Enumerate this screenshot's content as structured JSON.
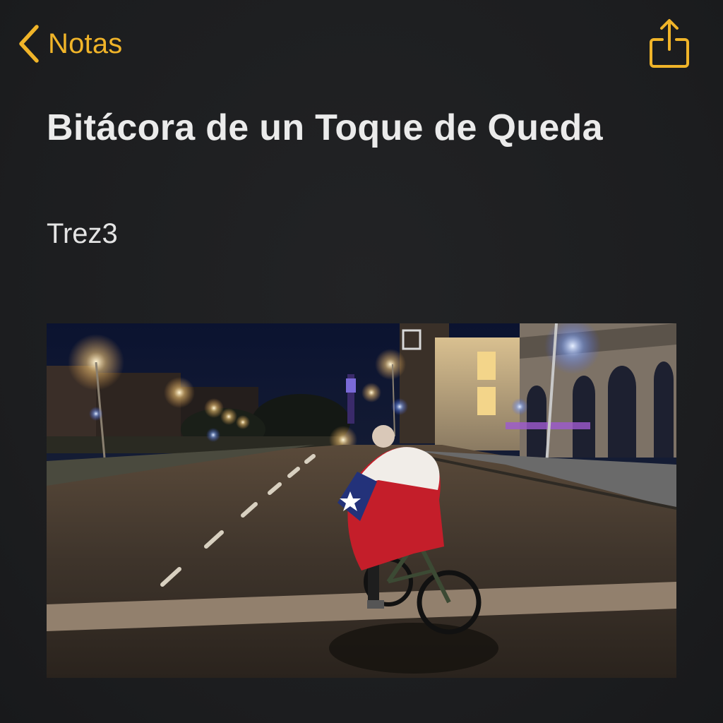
{
  "navigation": {
    "back_label": "Notas",
    "back_icon": "chevron-left-icon",
    "share_icon": "share-icon"
  },
  "note": {
    "title": "Bitácora de un Toque de Queda",
    "author": "Trez3"
  },
  "colors": {
    "accent": "#f0b429",
    "background": "#1d1e20",
    "text": "#ebebeb"
  }
}
